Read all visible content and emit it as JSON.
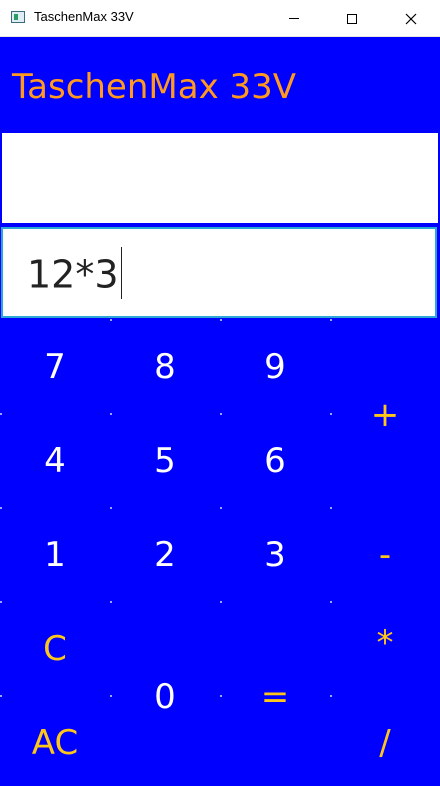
{
  "window": {
    "title": "TaschenMax 33V",
    "controls": {
      "minimize": "minimize",
      "maximize": "maximize",
      "close": "close"
    }
  },
  "app": {
    "title": "TaschenMax 33V",
    "title_color": "#ff9a1f",
    "background_color": "#0000ff"
  },
  "display": {
    "result": "",
    "input": "12*3"
  },
  "keypad": {
    "digit_color": "#ffffff",
    "operator_color": "#ffc61a",
    "keys": {
      "seven": "7",
      "eight": "8",
      "nine": "9",
      "plus": "+",
      "four": "4",
      "five": "5",
      "six": "6",
      "one": "1",
      "two": "2",
      "three": "3",
      "minus": "-",
      "clear": "C",
      "multiply": "*",
      "zero": "0",
      "equals": "=",
      "all_clear": "AC",
      "divide": "/"
    }
  }
}
